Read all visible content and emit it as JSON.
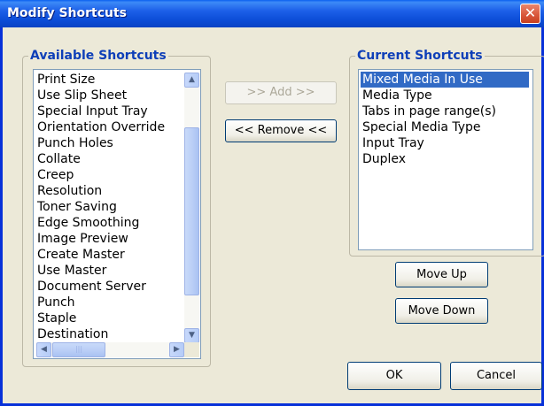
{
  "window": {
    "title": "Modify Shortcuts",
    "close_glyph": "✕"
  },
  "available": {
    "legend": "Available Shortcuts",
    "items": [
      "Print Size",
      "Use Slip Sheet",
      "Special Input Tray",
      "Orientation Override",
      "Punch Holes",
      "Collate",
      "Creep",
      "Resolution",
      "Toner Saving",
      "Edge Smoothing",
      "Image Preview",
      "Create Master",
      "Use Master",
      "Document Server",
      "Punch",
      "Staple",
      "Destination"
    ],
    "scroll_position": 0.55
  },
  "current": {
    "legend": "Current Shortcuts",
    "items": [
      "Mixed Media In Use",
      "Media Type",
      "Tabs in page range(s)",
      "Special Media Type",
      "Input Tray",
      "Duplex"
    ],
    "selected_index": 0
  },
  "buttons": {
    "add": ">> Add >>",
    "remove": "<< Remove <<",
    "move_up": "Move Up",
    "move_down": "Move Down",
    "ok": "OK",
    "cancel": "Cancel"
  },
  "scroll_glyphs": {
    "up": "▲",
    "down": "▼",
    "left": "◀",
    "right": "▶",
    "grip": "|||"
  },
  "colors": {
    "titlebar": "#0a5ff0",
    "legend": "#0e3fb8",
    "selection": "#316ac5"
  }
}
